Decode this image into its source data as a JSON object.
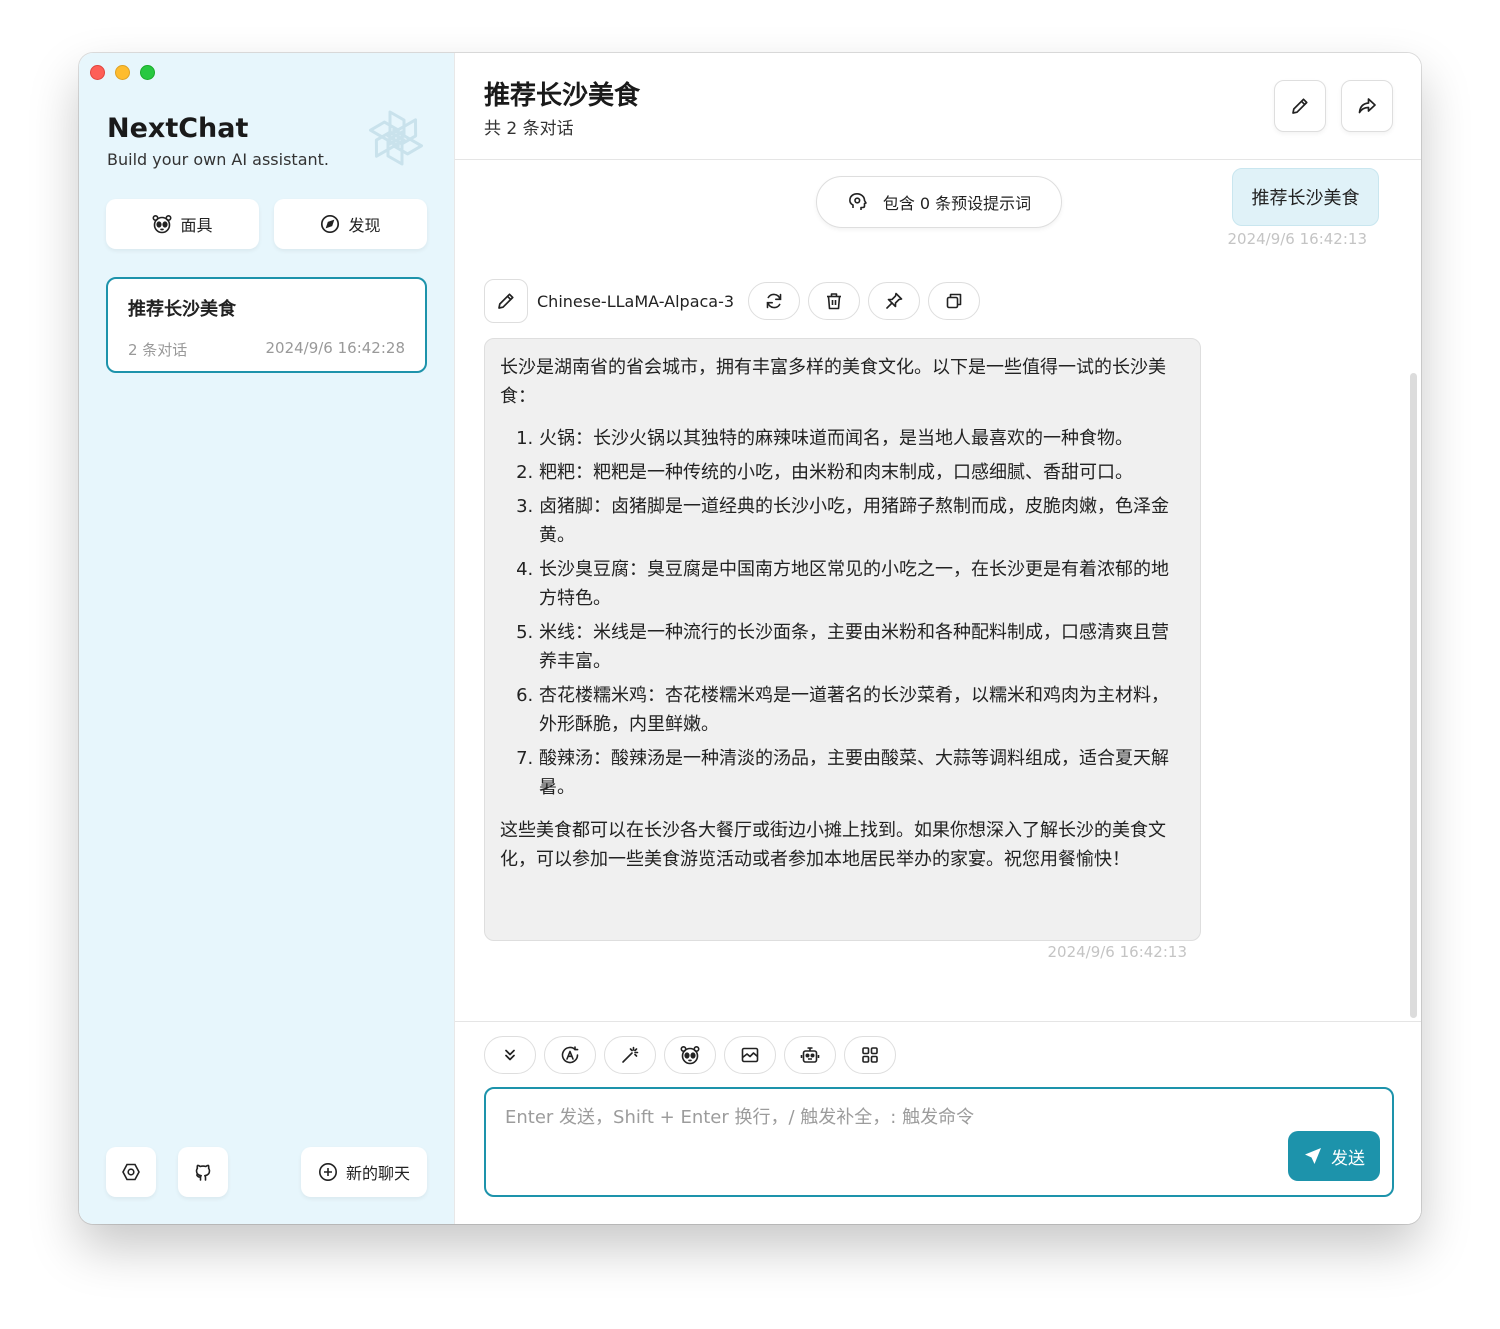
{
  "sidebar": {
    "title": "NextChat",
    "subtitle": "Build your own AI assistant.",
    "mask_label": "面具",
    "discover_label": "发现",
    "chats": [
      {
        "title": "推荐长沙美食",
        "count": "2 条对话",
        "time": "2024/9/6 16:42:28"
      }
    ],
    "new_chat_label": "新的聊天"
  },
  "header": {
    "title": "推荐长沙美食",
    "subtitle": "共 2 条对话"
  },
  "context": {
    "prompt_label": "包含 0 条预设提示词"
  },
  "user_message": {
    "text": "推荐长沙美食",
    "time": "2024/9/6 16:42:13"
  },
  "bot_message": {
    "model": "Chinese-LLaMA-Alpaca-3",
    "intro": "长沙是湖南省的省会城市，拥有丰富多样的美食文化。以下是一些值得一试的长沙美食：",
    "items": [
      "火锅：长沙火锅以其独特的麻辣味道而闻名，是当地人最喜欢的一种食物。",
      "粑粑：粑粑是一种传统的小吃，由米粉和肉末制成，口感细腻、香甜可口。",
      "卤猪脚：卤猪脚是一道经典的长沙小吃，用猪蹄子熬制而成，皮脆肉嫩，色泽金黄。",
      "长沙臭豆腐：臭豆腐是中国南方地区常见的小吃之一，在长沙更是有着浓郁的地方特色。",
      "米线：米线是一种流行的长沙面条，主要由米粉和各种配料制成，口感清爽且营养丰富。",
      "杏花楼糯米鸡：杏花楼糯米鸡是一道著名的长沙菜肴，以糯米和鸡肉为主材料，外形酥脆，内里鲜嫩。",
      "酸辣汤：酸辣汤是一种清淡的汤品，主要由酸菜、大蒜等调料组成，适合夏天解暑。"
    ],
    "outro": "这些美食都可以在长沙各大餐厅或街边小摊上找到。如果你想深入了解长沙的美食文化，可以参加一些美食游览活动或者参加本地居民举办的家宴。祝您用餐愉快！",
    "time": "2024/9/6 16:42:13"
  },
  "input": {
    "placeholder": "Enter 发送，Shift + Enter 换行，/ 触发补全，: 触发命令",
    "send_label": "发送"
  },
  "colors": {
    "accent": "#1d93ab",
    "sidebar_bg": "#e7f6fc"
  }
}
